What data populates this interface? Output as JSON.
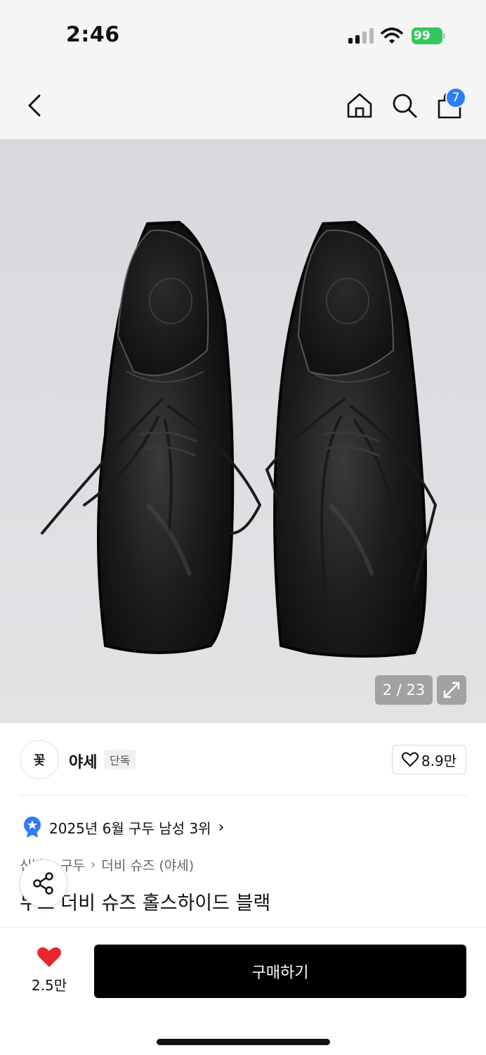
{
  "status_bar": {
    "time": "2:46",
    "battery": "99"
  },
  "nav": {
    "cart_count": "7"
  },
  "gallery": {
    "counter": "2 / 23"
  },
  "brand": {
    "logo_text": "꽃",
    "name": "야세",
    "badge": "단독",
    "likes": "8.9만"
  },
  "ranking": {
    "text": "2025년 6월 구두 남성 3위",
    "chevron": "›"
  },
  "breadcrumb": {
    "items": [
      "신발",
      "구두",
      "더비 슈즈 (야세)"
    ],
    "separator": "›"
  },
  "product": {
    "title": "누드 더비 슈즈 홀스하이드 블랙"
  },
  "bottom": {
    "fav_count": "2.5만",
    "buy_label": "구매하기"
  },
  "colors": {
    "accent_blue": "#2f7df6",
    "heart_red": "#e8262c",
    "battery_green": "#34c759"
  }
}
